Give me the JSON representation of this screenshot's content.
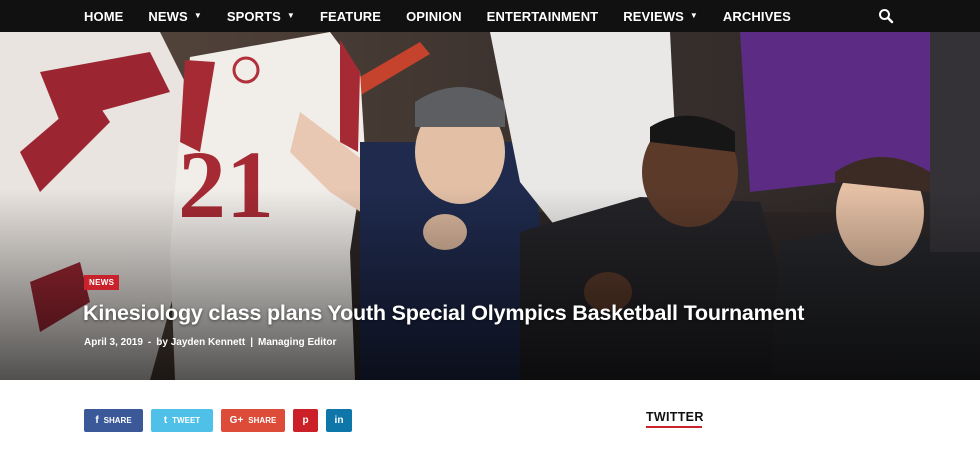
{
  "nav": {
    "items": [
      {
        "label": "HOME",
        "dropdown": false
      },
      {
        "label": "NEWS",
        "dropdown": true
      },
      {
        "label": "SPORTS",
        "dropdown": true
      },
      {
        "label": "FEATURE",
        "dropdown": false
      },
      {
        "label": "OPINION",
        "dropdown": false
      },
      {
        "label": "ENTERTAINMENT",
        "dropdown": false
      },
      {
        "label": "REVIEWS",
        "dropdown": true
      },
      {
        "label": "ARCHIVES",
        "dropdown": false
      }
    ],
    "search_icon": "search-icon"
  },
  "article": {
    "category": "NEWS",
    "headline": "Kinesiology class plans Youth Special Olympics Basketball Tournament",
    "date": "April 3, 2019",
    "byline": "by Jayden Kennett",
    "separator": "|",
    "role": "Managing Editor",
    "photo": {
      "jersey_number": "21"
    }
  },
  "share": {
    "buttons": [
      {
        "network": "facebook",
        "icon": "f",
        "label": "SHARE"
      },
      {
        "network": "twitter",
        "icon": "t",
        "label": "TWEET"
      },
      {
        "network": "google-plus",
        "icon": "G+",
        "label": "SHARE"
      },
      {
        "network": "pinterest",
        "icon": "p",
        "label": ""
      },
      {
        "network": "linkedin",
        "icon": "in",
        "label": ""
      }
    ]
  },
  "sidebar": {
    "title": "TWITTER"
  },
  "colors": {
    "nav_bg": "#111111",
    "accent": "#c8232c",
    "facebook": "#3b5998",
    "twitter": "#4fc1e9",
    "google_plus": "#dd4b39",
    "pinterest": "#cb2027",
    "linkedin": "#0e76a8"
  }
}
